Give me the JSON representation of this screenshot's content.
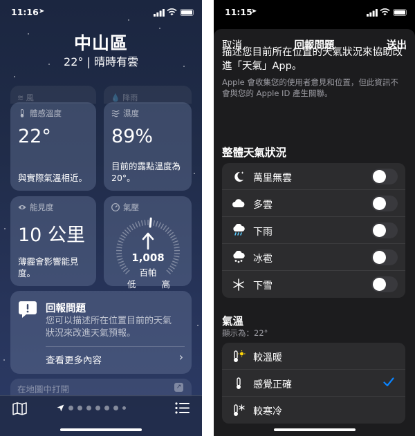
{
  "left": {
    "status": {
      "time": "11:16"
    },
    "city": "中山區",
    "summary": "22° | 晴時有雲",
    "ghost_tiles": [
      {
        "label": "風"
      },
      {
        "label": "降雨"
      }
    ],
    "tiles": {
      "feels_like": {
        "label": "體感溫度",
        "value": "22°",
        "note": "與實際氣溫相近。"
      },
      "humidity": {
        "label": "濕度",
        "value": "89%",
        "note": "目前的露點溫度為 20°。"
      },
      "visibility": {
        "label": "能見度",
        "value": "10 公里",
        "note": "薄霾會影響能見度。"
      },
      "pressure": {
        "label": "氣壓",
        "value": "1,008",
        "unit": "百帕",
        "low": "低",
        "high": "高"
      }
    },
    "report": {
      "title": "回報問題",
      "desc": "您可以描述所在位置目前的天氣狀況來改進天氣預報。",
      "more": "查看更多內容",
      "chevron": "›"
    },
    "open_map": {
      "label": "在地圖中打開",
      "icon": "↗"
    },
    "page_dots": 7
  },
  "right": {
    "status": {
      "time": "11:15"
    },
    "nav": {
      "cancel": "取消",
      "title": "回報問題",
      "send": "送出"
    },
    "intro": "描述您目前所在位置的天氣狀況來協助改進「天氣」App。",
    "privacy": "Apple 會收集您的使用者意見和位置，但此資訊不會與您的 Apple ID 產生關聯。",
    "conditions": {
      "header": "整體天氣狀況",
      "items": [
        {
          "label": "萬里無雲",
          "icon": "moon-star-icon",
          "on": false
        },
        {
          "label": "多雲",
          "icon": "cloud-icon",
          "on": false
        },
        {
          "label": "下雨",
          "icon": "cloud-rain-icon",
          "on": false
        },
        {
          "label": "冰雹",
          "icon": "cloud-hail-icon",
          "on": false
        },
        {
          "label": "下雪",
          "icon": "snowflake-icon",
          "on": false
        }
      ]
    },
    "temperature": {
      "header": "氣溫",
      "sub": "顯示為：22°",
      "items": [
        {
          "label": "較溫暖",
          "icon": "thermometer-sun-icon",
          "checked": false
        },
        {
          "label": "感覺正確",
          "icon": "thermometer-icon",
          "checked": true
        },
        {
          "label": "較寒冷",
          "icon": "thermometer-snow-icon",
          "checked": false
        }
      ]
    }
  },
  "colors": {
    "accent": "#0a84ff",
    "sun": "#ffd60a",
    "toggle_off": "#39393d"
  }
}
